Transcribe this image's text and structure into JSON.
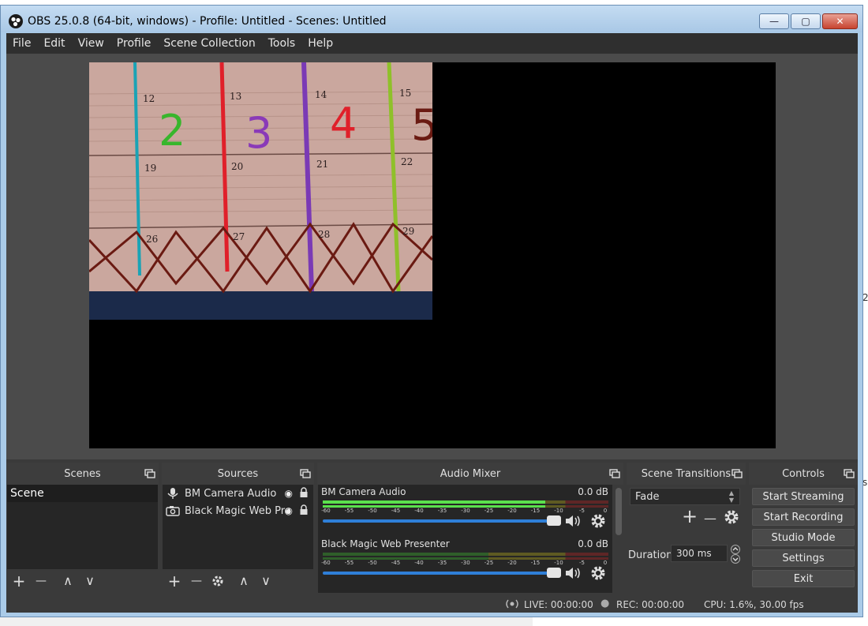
{
  "window": {
    "title": "OBS 25.0.8 (64-bit, windows) - Profile: Untitled - Scenes: Untitled",
    "minimize_glyph": "—",
    "maximize_glyph": "▢",
    "close_glyph": "✕"
  },
  "menu": [
    "File",
    "Edit",
    "View",
    "Profile",
    "Scene Collection",
    "Tools",
    "Help"
  ],
  "preview": {
    "calendar_dates_top": [
      "12",
      "13",
      "14",
      "15"
    ],
    "calendar_dates_mid": [
      "19",
      "20",
      "21",
      "22"
    ],
    "calendar_dates_bottom": [
      "26",
      "27",
      "28",
      "29"
    ],
    "handwritten_digits": [
      "2",
      "3",
      "4",
      "5"
    ]
  },
  "scenes": {
    "title": "Scenes",
    "items": [
      "Scene"
    ],
    "add": "+",
    "remove": "—",
    "up": "∧",
    "down": "∨"
  },
  "sources": {
    "title": "Sources",
    "items": [
      {
        "name": "BM Camera Audio",
        "icon": "microphone-icon"
      },
      {
        "name": "Black Magic Web Pre",
        "icon": "camera-icon"
      }
    ],
    "add": "+",
    "remove": "—",
    "up": "∧",
    "down": "∨"
  },
  "mixer": {
    "title": "Audio Mixer",
    "ticks": [
      "-60",
      "-55",
      "-50",
      "-45",
      "-40",
      "-35",
      "-30",
      "-25",
      "-20",
      "-15",
      "-10",
      "-5",
      "0"
    ],
    "channels": [
      {
        "name": "BM Camera Audio",
        "db": "0.0 dB",
        "level": 0.78,
        "volume": 1.0
      },
      {
        "name": "Black Magic Web Presenter",
        "db": "0.0 dB",
        "level": 0.0,
        "volume": 1.0
      }
    ]
  },
  "transitions": {
    "title": "Scene Transitions",
    "selected": "Fade",
    "add": "+",
    "remove": "—",
    "duration_label": "Duration",
    "duration_value": "300 ms"
  },
  "controls": {
    "title": "Controls",
    "buttons": [
      "Start Streaming",
      "Start Recording",
      "Studio Mode",
      "Settings",
      "Exit"
    ]
  },
  "status": {
    "live": "LIVE: 00:00:00",
    "rec": "REC: 00:00:00",
    "cpu": "CPU: 1.6%, 30.00 fps"
  },
  "colors": {
    "accent": "#2f7fd8",
    "meter_green": "#5be04d",
    "dock_bg": "#3a3a3a",
    "list_bg": "#262626"
  }
}
